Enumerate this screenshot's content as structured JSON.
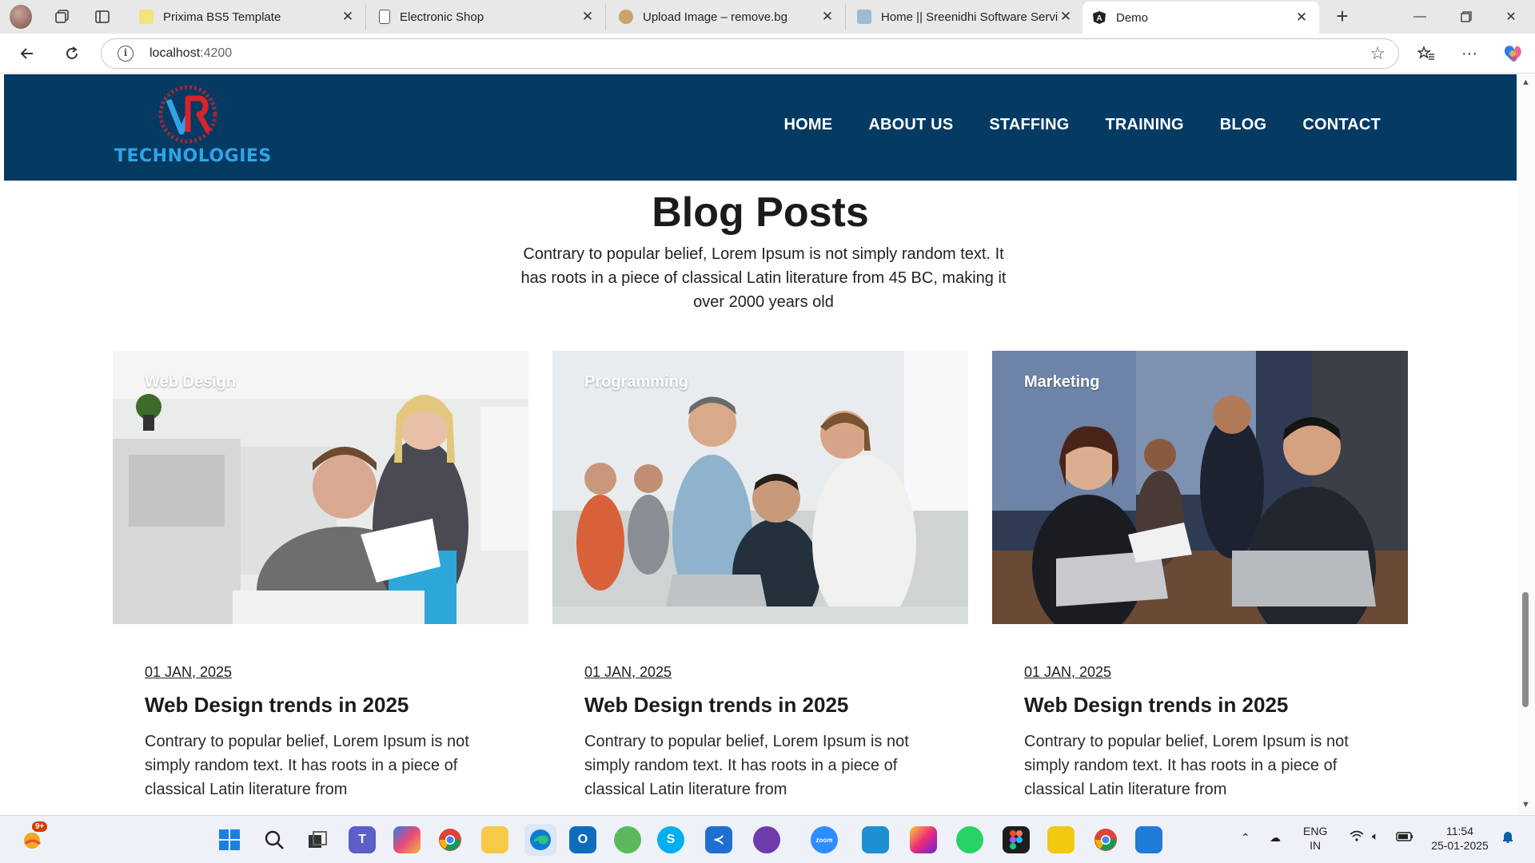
{
  "browser": {
    "tabs": [
      {
        "title": "Prixima BS5 Template",
        "favicon_color": "#f4e27a"
      },
      {
        "title": "Electronic Shop",
        "favicon_color": "#ffffff"
      },
      {
        "title": "Upload Image – remove.bg",
        "favicon_color": "#c9a36a"
      },
      {
        "title": "Home || Sreenidhi Software Servic",
        "favicon_color": "#9bbbd6"
      },
      {
        "title": "Demo",
        "favicon_color": "#222222",
        "active": true
      }
    ],
    "new_tab": "+",
    "address": {
      "host": "localhost",
      "port": ":4200"
    }
  },
  "site": {
    "logo": {
      "text": "TECHNOLOGIES",
      "mark_letters": "VR"
    },
    "nav": [
      "HOME",
      "ABOUT US",
      "STAFFING",
      "TRAINING",
      "BLOG",
      "CONTACT"
    ]
  },
  "blog": {
    "title": "Blog Posts",
    "intro": "Contrary to popular belief, Lorem Ipsum is not simply random text. It has roots in a piece of classical Latin literature from 45 BC, making it over 2000 years old",
    "cards": [
      {
        "category": "Web Design",
        "date": "01 JAN, 2025",
        "title": "Web Design trends in 2025",
        "excerpt": "Contrary to popular belief, Lorem Ipsum is not simply random text. It has roots in a piece of classical Latin literature from"
      },
      {
        "category": "Programming",
        "date": "01 JAN, 2025",
        "title": "Web Design trends in 2025",
        "excerpt": "Contrary to popular belief, Lorem Ipsum is not simply random text. It has roots in a piece of classical Latin literature from"
      },
      {
        "category": "Marketing",
        "date": "01 JAN, 2025",
        "title": "Web Design trends in 2025",
        "excerpt": "Contrary to popular belief, Lorem Ipsum is not simply random text. It has roots in a piece of classical Latin literature from"
      }
    ]
  },
  "taskbar": {
    "weather_badge": "9+",
    "lang": "ENG",
    "region": "IN",
    "time": "11:54",
    "date": "25-01-2025"
  },
  "colors": {
    "header_bg": "#053a63",
    "accent_blue": "#0d66e8",
    "logo_blue": "#2fa4e7",
    "logo_red": "#d8232a"
  }
}
